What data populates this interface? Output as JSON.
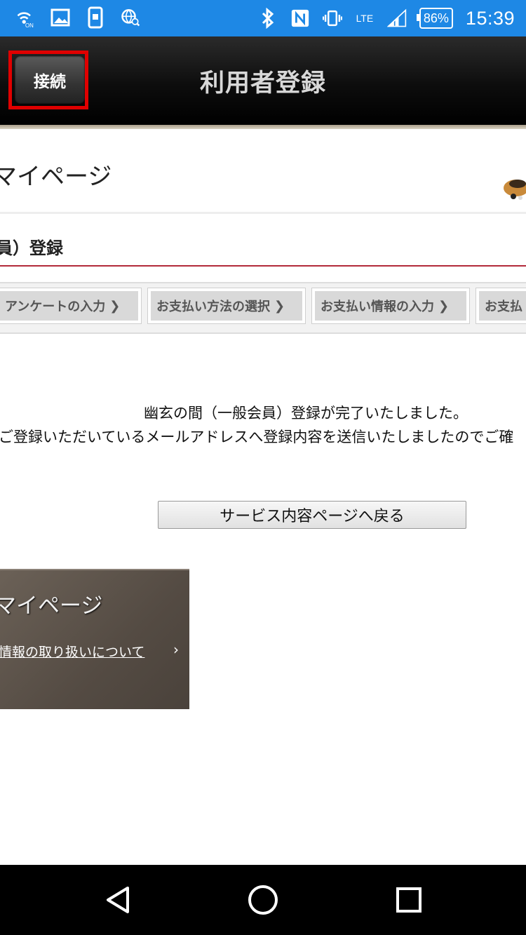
{
  "status_bar": {
    "battery": "86%",
    "time": "15:39",
    "network": "LTE",
    "colors": {
      "background": "#1e88e5"
    },
    "icons": [
      "wifi-calling-icon",
      "gallery-icon",
      "phone-screen-icon",
      "globe-search-icon",
      "bluetooth-icon",
      "nfc-icon",
      "vibrate-icon",
      "lte-icon",
      "signal-icon",
      "battery-icon"
    ]
  },
  "app_bar": {
    "connect_button": "接続",
    "title": "利用者登録"
  },
  "web": {
    "mypage_header": "マイページ",
    "registration_heading": "員）登録",
    "steps": [
      {
        "label": "アンケートの入力"
      },
      {
        "label": "お支払い方法の選択"
      },
      {
        "label": "お支払い情報の入力"
      },
      {
        "label": "お支払"
      }
    ],
    "message_line1": "幽玄の間（一般会員）登録が完了いたしました。",
    "message_line2": "ご登録いただいているメールアドレスへ登録内容を送信いたしましたのでご確",
    "back_button": "サービス内容ページへ戻る",
    "side_panel": {
      "title": "マイページ",
      "link": "情報の取り扱いについて"
    },
    "colors": {
      "heading_rule": "#b22a3a",
      "panel": "#5c534b"
    }
  },
  "nav_bar": {
    "buttons": [
      "back-icon",
      "home-icon",
      "recents-icon"
    ]
  }
}
